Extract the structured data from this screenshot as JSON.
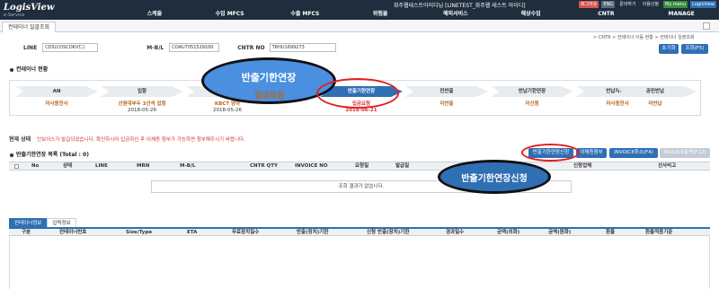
{
  "app": {
    "logo": "LogisView",
    "logo_sub": "e-Service"
  },
  "user": {
    "info": "화주웹테스트아이디님 [LINETEST_화주웹 테스트 아이디]"
  },
  "top_links": [
    {
      "label": "로그아웃",
      "color": "#d9534f"
    },
    {
      "label": "ENG",
      "color": "#5b6b7d"
    },
    {
      "label": "문의하기",
      "color": "#5b6b7d"
    },
    {
      "label": "이용신청",
      "color": "#5b6b7d"
    },
    {
      "label": "My menu",
      "color": "#3a8e3a"
    },
    {
      "label": "LogisView",
      "color": "#2f6fb4"
    }
  ],
  "nav": {
    "items": [
      "스케줄",
      "수입 MFCS",
      "수출 MFCS",
      "위험물",
      "해외서비스",
      "해상수입",
      "CNTR",
      "MANAGE"
    ]
  },
  "page_tab": "컨테이너 일괄조회",
  "breadcrumb": "> CNTR > 컨테이너 이동 현황 > 컨테이너 일괄조회",
  "search": {
    "line_label": "LINE",
    "line_value": "CDS(COSCOKV仁)",
    "mbl_label": "M-B/L",
    "mbl_value": "COAU7051529100",
    "cntr_label": "CNTR NO",
    "cntr_value": "TRHU1699273"
  },
  "buttons": {
    "reset": "초기화",
    "search": "조회(F5)"
  },
  "status_section": {
    "title": "컨테이너 현황"
  },
  "steps": [
    {
      "name": "AN",
      "status": "미사용전사",
      "date": "",
      "active": false
    },
    {
      "name": "입항",
      "status": "선원대부두 3선석 입항",
      "date": "2018-05-26",
      "active": false
    },
    {
      "name": "하역",
      "status": "KBCT 양하",
      "date": "2018-05-26",
      "active": false
    },
    {
      "name": "반출기한연장",
      "status": "입금요청",
      "date": "2018-06-21",
      "active": true
    },
    {
      "name": "컨반출",
      "status": "미반출",
      "date": "",
      "active": false
    },
    {
      "name": "반납기한연장",
      "status": "미신청",
      "date": "",
      "active": false
    },
    {
      "name": "반납지변경",
      "status": "미사용전사",
      "date": "",
      "active": false
    },
    {
      "name": "공컨반납",
      "status": "미반납",
      "date": "",
      "active": false
    }
  ],
  "note": {
    "label": "현재 상태",
    "text": "인보이스가 발급되었습니다. 확인하시어 입금하신 후 이체증 첨부가 가능하면 첨부해주시기 바랍니다."
  },
  "list_section": {
    "title": "반출기한연장 목록 (Total : 0)"
  },
  "action_buttons": {
    "extension_apply": "반출기한연장신청",
    "attach_transfer": "이체증첨부",
    "invoice_cancel": "INVOICE취소(F4)",
    "invoice_print": "INVOICE출력(F12)"
  },
  "grid": {
    "headers": [
      "No",
      "상태",
      "LINE",
      "MRN",
      "M-B/L",
      "CNTR QTY",
      "INVOICE NO",
      "요청일",
      "발급일",
      "",
      "",
      "신청업체",
      "선사비고"
    ],
    "empty_message": "조회 결과가 없습니다."
  },
  "lower_tabs": [
    "컨테이너정보",
    "입력정보"
  ],
  "lower_grid": {
    "headers": [
      "구분",
      "컨테이너번호",
      "Size/Type",
      "ETA",
      "무료장치일수",
      "반출(장치)기한",
      "신청 반출(장치)기한",
      "경과일수",
      "금액(외화)",
      "금액(원화)",
      "환율",
      "환율적용기준"
    ]
  },
  "overlays": {
    "callout_top_line1": "반출기한연장",
    "callout_top_line2": "입금요청",
    "callout_right": "반출기한연장신청"
  }
}
